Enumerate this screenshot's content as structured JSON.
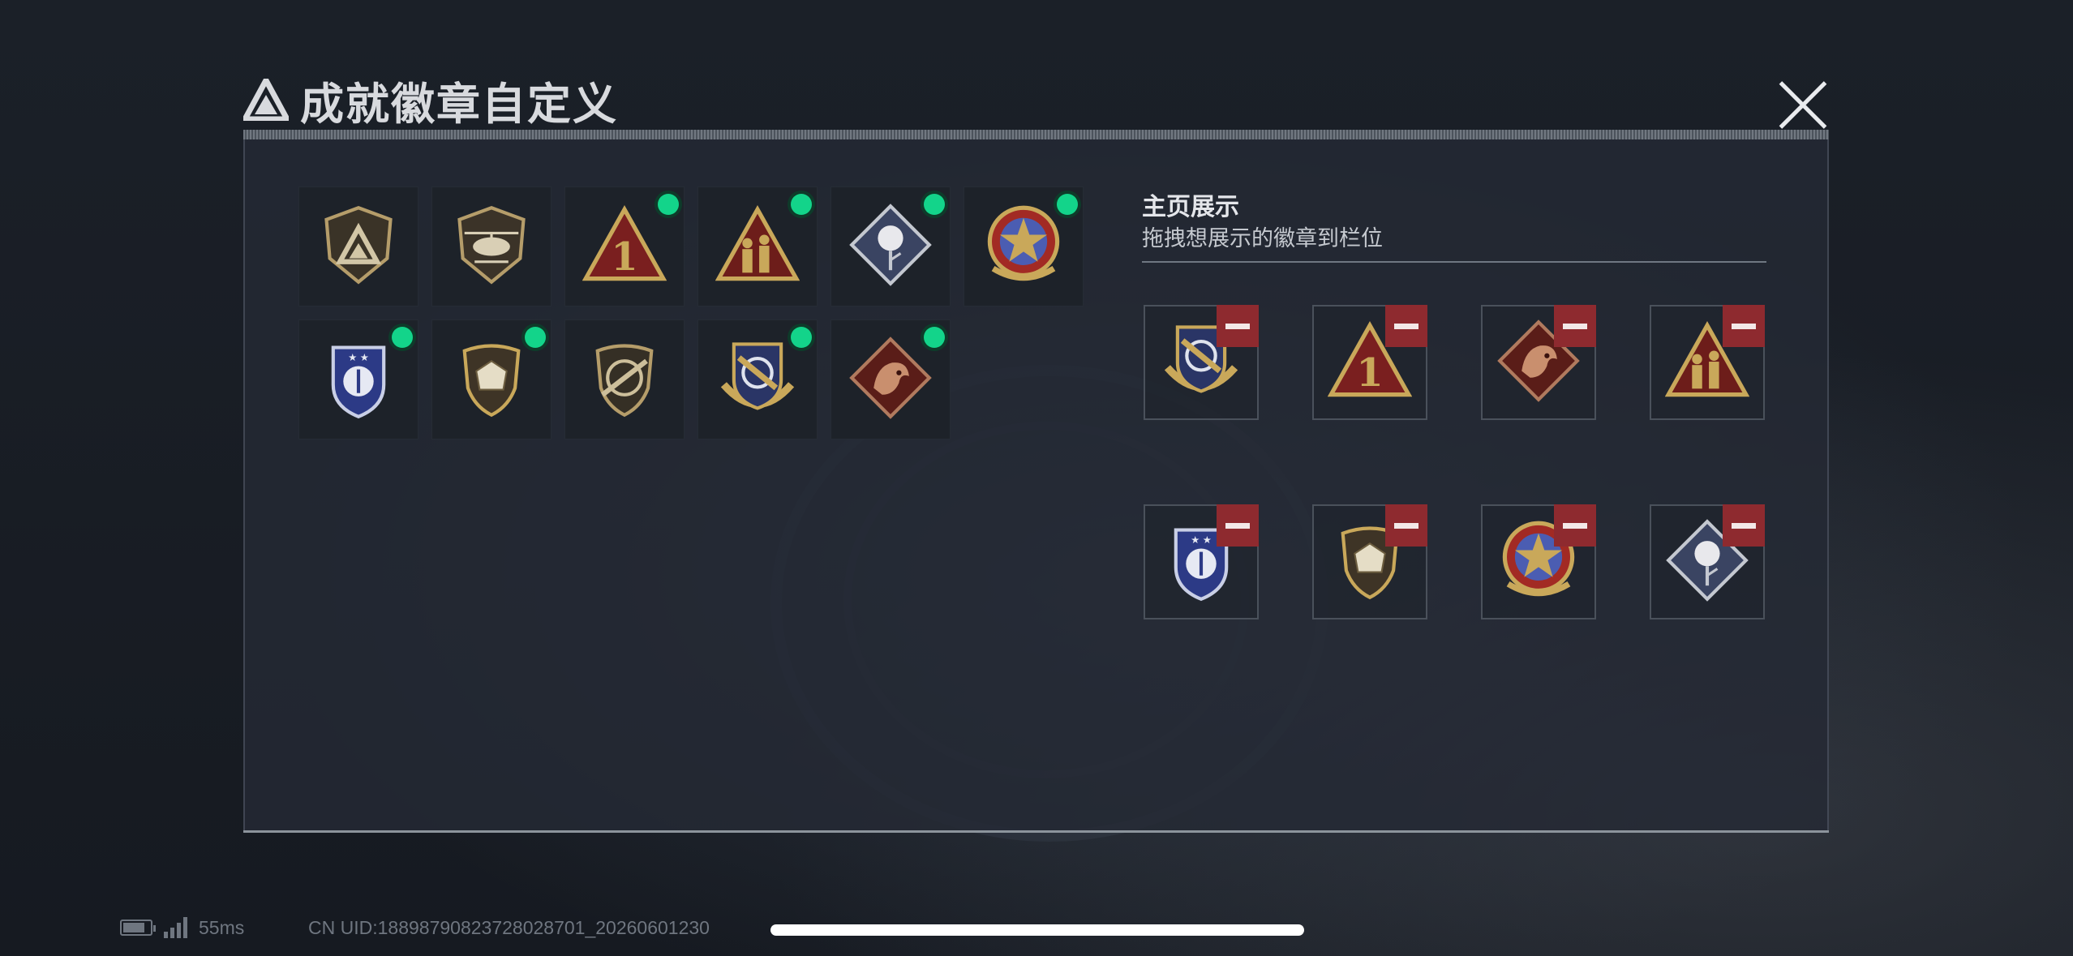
{
  "window": {
    "title": "成就徽章自定义",
    "close_icon": "close-icon"
  },
  "collection": {
    "badges": [
      {
        "icon": "triangle-shield-badge",
        "equipped": false
      },
      {
        "icon": "helicopter-badge",
        "equipped": false
      },
      {
        "icon": "number-one-triangle-badge",
        "equipped": true
      },
      {
        "icon": "soldiers-triangle-badge",
        "equipped": true
      },
      {
        "icon": "rose-diamond-badge",
        "equipped": true
      },
      {
        "icon": "star-medal-badge",
        "equipped": true
      },
      {
        "icon": "police-shield-badge",
        "equipped": true
      },
      {
        "icon": "polyhedron-shield-badge",
        "equipped": true
      },
      {
        "icon": "rifle-crest-badge",
        "equipped": false
      },
      {
        "icon": "crosshair-shield-badge",
        "equipped": true
      },
      {
        "icon": "dragon-diamond-badge",
        "equipped": true
      }
    ]
  },
  "homepage_display": {
    "title": "主页展示",
    "subtitle": "拖拽想展示的徽章到栏位",
    "slots": [
      {
        "icon": "crosshair-shield-badge",
        "remove_icon": "minus-icon"
      },
      {
        "icon": "number-one-triangle-badge",
        "remove_icon": "minus-icon"
      },
      {
        "icon": "dragon-diamond-badge",
        "remove_icon": "minus-icon"
      },
      {
        "icon": "soldiers-triangle-badge",
        "remove_icon": "minus-icon"
      },
      {
        "icon": "police-shield-badge",
        "remove_icon": "minus-icon"
      },
      {
        "icon": "polyhedron-shield-badge",
        "remove_icon": "minus-icon"
      },
      {
        "icon": "star-medal-badge",
        "remove_icon": "minus-icon"
      },
      {
        "icon": "rose-diamond-badge",
        "remove_icon": "minus-icon"
      }
    ]
  },
  "status": {
    "ping": "55ms",
    "uid": "CN UID:1889879082372802870​1_20260601230",
    "colors": {
      "equipped_dot": "#13d48a",
      "remove_button": "#8e2a2f",
      "gold": "#c9a85a"
    }
  }
}
